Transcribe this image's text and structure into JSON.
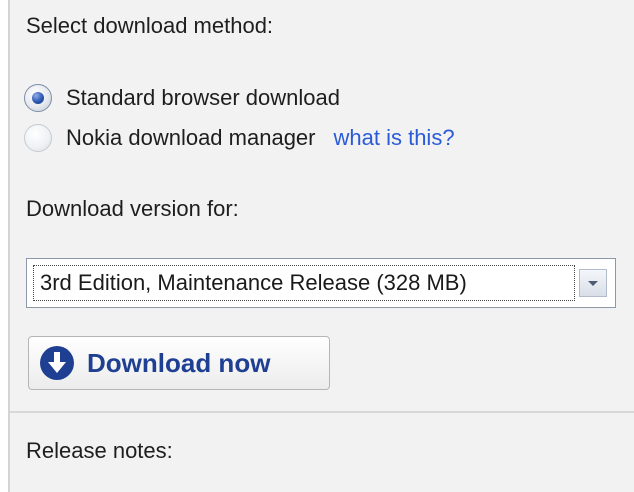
{
  "method": {
    "label": "Select download method:",
    "options": [
      {
        "label": "Standard browser download",
        "selected": true
      },
      {
        "label": "Nokia download manager",
        "selected": false
      }
    ],
    "help_link": "what is this?"
  },
  "version": {
    "label": "Download version for:",
    "selected_value": "3rd Edition, Maintenance Release (328 MB)"
  },
  "download_button": {
    "label": "Download now",
    "icon": "download-arrow-icon"
  },
  "release_notes": {
    "label": "Release notes:"
  },
  "colors": {
    "link": "#2a5bd7",
    "button_text": "#1f3f93",
    "panel_bg": "#f2f2f2"
  }
}
